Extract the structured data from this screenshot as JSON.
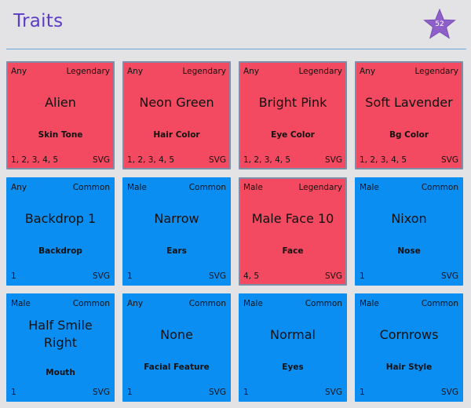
{
  "header": {
    "title": "Traits",
    "star_count": "52",
    "star_color": "#8e5fc8"
  },
  "colors": {
    "legendary": "#f44a61",
    "common": "#0a8ef2",
    "title": "#5b3cc4"
  },
  "cards": [
    {
      "gender": "Any",
      "rarity": "Legendary",
      "name": "Alien",
      "category": "Skin Tone",
      "values": "1, 2, 3, 4, 5",
      "format": "SVG"
    },
    {
      "gender": "Any",
      "rarity": "Legendary",
      "name": "Neon Green",
      "category": "Hair Color",
      "values": "1, 2, 3, 4, 5",
      "format": "SVG"
    },
    {
      "gender": "Any",
      "rarity": "Legendary",
      "name": "Bright Pink",
      "category": "Eye Color",
      "values": "1, 2, 3, 4, 5",
      "format": "SVG"
    },
    {
      "gender": "Any",
      "rarity": "Legendary",
      "name": "Soft Lavender",
      "category": "Bg Color",
      "values": "1, 2, 3, 4, 5",
      "format": "SVG"
    },
    {
      "gender": "Any",
      "rarity": "Common",
      "name": "Backdrop 1",
      "category": "Backdrop",
      "values": "1",
      "format": "SVG"
    },
    {
      "gender": "Male",
      "rarity": "Common",
      "name": "Narrow",
      "category": "Ears",
      "values": "1",
      "format": "SVG"
    },
    {
      "gender": "Male",
      "rarity": "Legendary",
      "name": "Male Face 10",
      "category": "Face",
      "values": "4, 5",
      "format": "SVG"
    },
    {
      "gender": "Male",
      "rarity": "Common",
      "name": "Nixon",
      "category": "Nose",
      "values": "1",
      "format": "SVG"
    },
    {
      "gender": "Male",
      "rarity": "Common",
      "name": "Half Smile Right",
      "category": "Mouth",
      "values": "1",
      "format": "SVG"
    },
    {
      "gender": "Any",
      "rarity": "Common",
      "name": "None",
      "category": "Facial Feature",
      "values": "1",
      "format": "SVG"
    },
    {
      "gender": "Male",
      "rarity": "Common",
      "name": "Normal",
      "category": "Eyes",
      "values": "1",
      "format": "SVG"
    },
    {
      "gender": "Male",
      "rarity": "Common",
      "name": "Cornrows",
      "category": "Hair Style",
      "values": "1",
      "format": "SVG"
    }
  ]
}
